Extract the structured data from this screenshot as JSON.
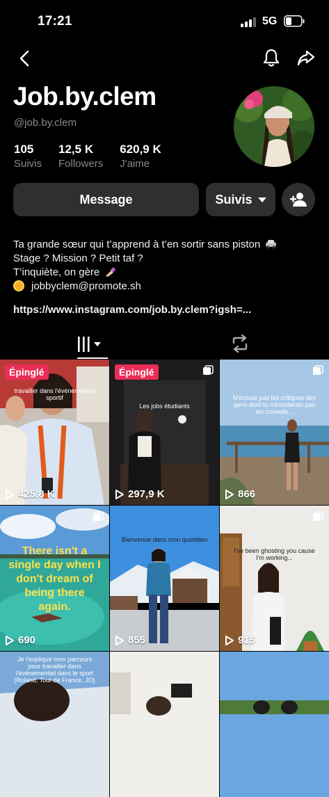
{
  "status": {
    "time": "17:21",
    "network": "5G"
  },
  "profile": {
    "name": "Job.by.clem",
    "handle": "@job.by.clem",
    "stats": [
      {
        "value": "105",
        "label": "Suivis"
      },
      {
        "value": "12,5 K",
        "label": "Followers"
      },
      {
        "value": "620,9 K",
        "label": "J'aime"
      }
    ]
  },
  "actions": {
    "message": "Message",
    "follow": "Suivis"
  },
  "bio": {
    "line1": "Ta grande sœur qui t’apprend à t’en sortir sans piston",
    "line2": "Stage ? Mission ? Petit taf ?",
    "line3": "T’inquiète, on gère",
    "line4": "jobbyclem@promote.sh",
    "link": "https://www.instagram.com/job.by.clem?igsh=..."
  },
  "videos": [
    {
      "pinned": "Épinglé",
      "views": "425,8 K",
      "caption": "travailler dans l'événementiel sportif"
    },
    {
      "pinned": "Épinglé",
      "views": "297,9 K",
      "caption": "Les jobs étudiants"
    },
    {
      "views": "866",
      "caption": "N'écoute pas les critiques des gens dont tu n'écouterais pas les conseils..."
    },
    {
      "views": "690",
      "caption": "There isn't a single day when I don't dream of being there again."
    },
    {
      "views": "855",
      "caption": "Bienvenue dans mon quotidien"
    },
    {
      "views": "915",
      "caption": "I've been ghosting you cause I'm working..."
    },
    {
      "caption": "Je t'explique mon parcours pour travailler dans l'événementiel dans le sport (Roland, Tour de France, JO)"
    },
    {
      "caption": ""
    },
    {
      "caption": ""
    }
  ]
}
